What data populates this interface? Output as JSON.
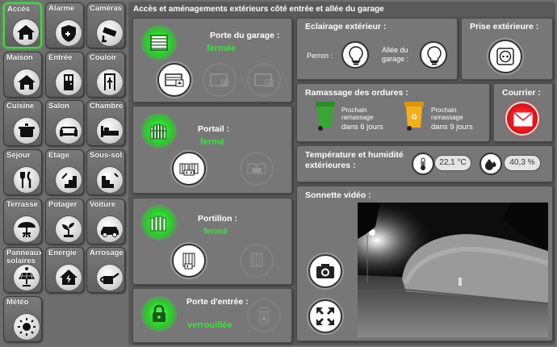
{
  "sidebar": {
    "items": [
      {
        "label": "Accès",
        "icon": "house-icon",
        "active": true
      },
      {
        "label": "Alarme",
        "icon": "shield-icon"
      },
      {
        "label": "Caméras",
        "icon": "camera-cctv-icon"
      },
      {
        "label": "Maison",
        "icon": "house-icon"
      },
      {
        "label": "Entrée",
        "icon": "door-icon"
      },
      {
        "label": "Couloir",
        "icon": "corridor-icon"
      },
      {
        "label": "Cuisine",
        "icon": "pot-icon"
      },
      {
        "label": "Salon",
        "icon": "sofa-icon"
      },
      {
        "label": "Chambre",
        "icon": "bed-icon"
      },
      {
        "label": "Séjour",
        "icon": "cutlery-icon"
      },
      {
        "label": "Etage",
        "icon": "stairs-up-icon"
      },
      {
        "label": "Sous-sol",
        "icon": "stairs-down-icon"
      },
      {
        "label": "Terrasse",
        "icon": "parasol-icon"
      },
      {
        "label": "Potager",
        "icon": "plant-icon"
      },
      {
        "label": "Voiture",
        "icon": "car-icon"
      },
      {
        "label": "Panneaux solaires",
        "icon": "solar-panel-icon"
      },
      {
        "label": "Energie",
        "icon": "energy-house-icon"
      },
      {
        "label": "Arrosage",
        "icon": "watering-can-icon"
      },
      {
        "label": "Météo",
        "icon": "weather-icon"
      }
    ]
  },
  "header": {
    "title": "Accès et aménagements extérieurs côté entrée et allée du garage"
  },
  "garage": {
    "title": "Porte du garage :",
    "state": "fermée"
  },
  "portail": {
    "title": "Portail :",
    "state": "fermé"
  },
  "portillon": {
    "title": "Portillon :",
    "state": "fermé"
  },
  "door": {
    "title": "Porte d'entrée :",
    "state": "verrouillée"
  },
  "lighting": {
    "title": "Eclairage extérieur :",
    "perron": "Perron :",
    "allee": "Allée du garage :"
  },
  "plug": {
    "title": "Prise extérieure :"
  },
  "trash": {
    "title": "Ramassage des ordures :",
    "green": {
      "label": "Prochain ramassage :",
      "value": "dans 6 jours",
      "color": "#3aa535"
    },
    "yellow": {
      "label": "Prochain ramassage :",
      "value": "dans 9 jours",
      "color": "#f2b01e"
    }
  },
  "mail": {
    "title": "Courrier :",
    "color": "#e8191e"
  },
  "climate": {
    "title": "Température et humidité extérieures :",
    "temperature": "22,1 °C",
    "humidity": "40,3 %"
  },
  "video": {
    "title": "Sonnette vidéo :"
  }
}
